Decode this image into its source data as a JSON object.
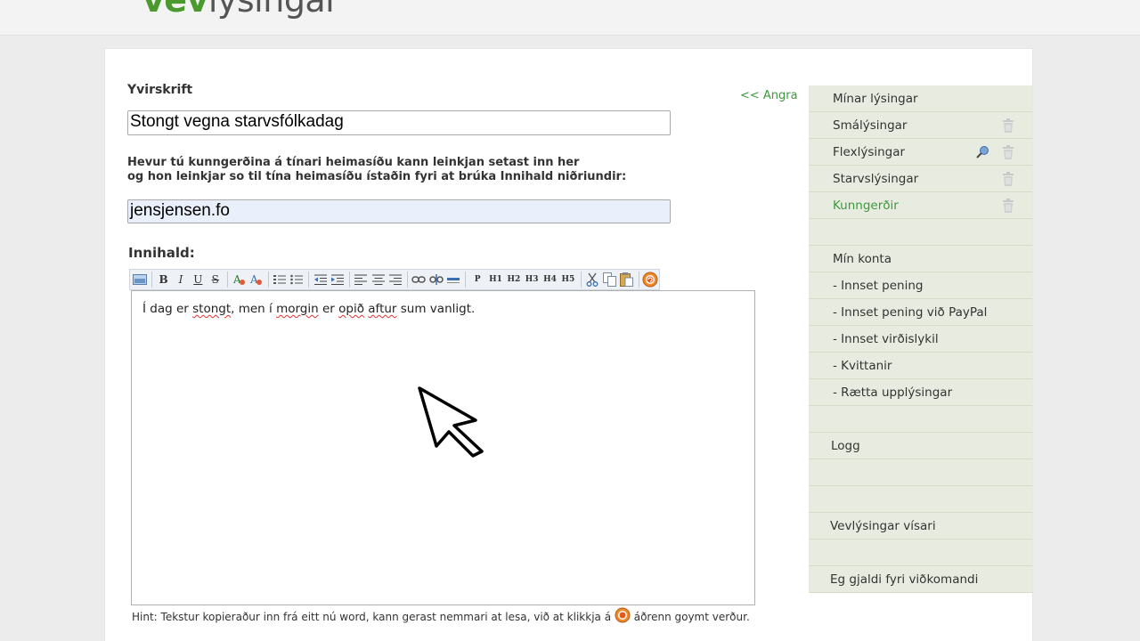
{
  "logo": {
    "part1": "vev",
    "part2": "lýsingar"
  },
  "form": {
    "title_label": "Yvirskrift",
    "title_value": "Stongt vegna starvsfólkadag",
    "link_desc_line1": "Hevur tú kunngerðina á tínari heimasíðu kann leinkjan setast inn her",
    "link_desc_line2": "og hon leinkjar so til tína heimasíðu ístaðin fyri at brúka Innihald niðriundir:",
    "link_value": "jensjensen.fo",
    "content_label": "Innihald:",
    "back_link": "<< Angra"
  },
  "editor": {
    "toolbar_headings": [
      "P",
      "H1",
      "H2",
      "H3",
      "H4",
      "H5"
    ],
    "text": {
      "w1": "Í dag er ",
      "w2": "stongt",
      "w3": ", men í ",
      "w4": "morgin",
      "w5": " er ",
      "w6": "opið",
      "w7": " ",
      "w8": "aftur",
      "w9": " sum vanligt."
    }
  },
  "hint": {
    "before": "Hint: Tekstur kopieraður inn frá eitt nú word, kann gerast nemmari at lesa, við at klikkja á",
    "after": "áðrenn goymt verður."
  },
  "sidebar": {
    "items": [
      {
        "label": "Mínar lýsingar"
      },
      {
        "label": "Smálýsingar"
      },
      {
        "label": "Flexlýsingar"
      },
      {
        "label": "Starvslýsingar"
      },
      {
        "label": "Kunngerðir"
      },
      {
        "label": ""
      },
      {
        "label": "Mín konta"
      },
      {
        "label": "- Innset pening"
      },
      {
        "label": "- Innset pening við PayPal"
      },
      {
        "label": "- Innset virðislykil"
      },
      {
        "label": "- Kvittanir"
      },
      {
        "label": "- Rætta upplýsingar"
      },
      {
        "label": ""
      },
      {
        "label": "Logg"
      },
      {
        "label": ""
      },
      {
        "label": ""
      },
      {
        "label": "Vevlýsingar vísari"
      },
      {
        "label": ""
      },
      {
        "label": "Eg gjaldi fyri viðkomandi"
      }
    ]
  },
  "colors": {
    "accent_green": "#3c9a3c",
    "sidebar_bg": "#e8ece0"
  },
  "icons": [
    "trash-icon",
    "pin-icon",
    "cleanup-icon",
    "mouse-pointer-icon"
  ]
}
